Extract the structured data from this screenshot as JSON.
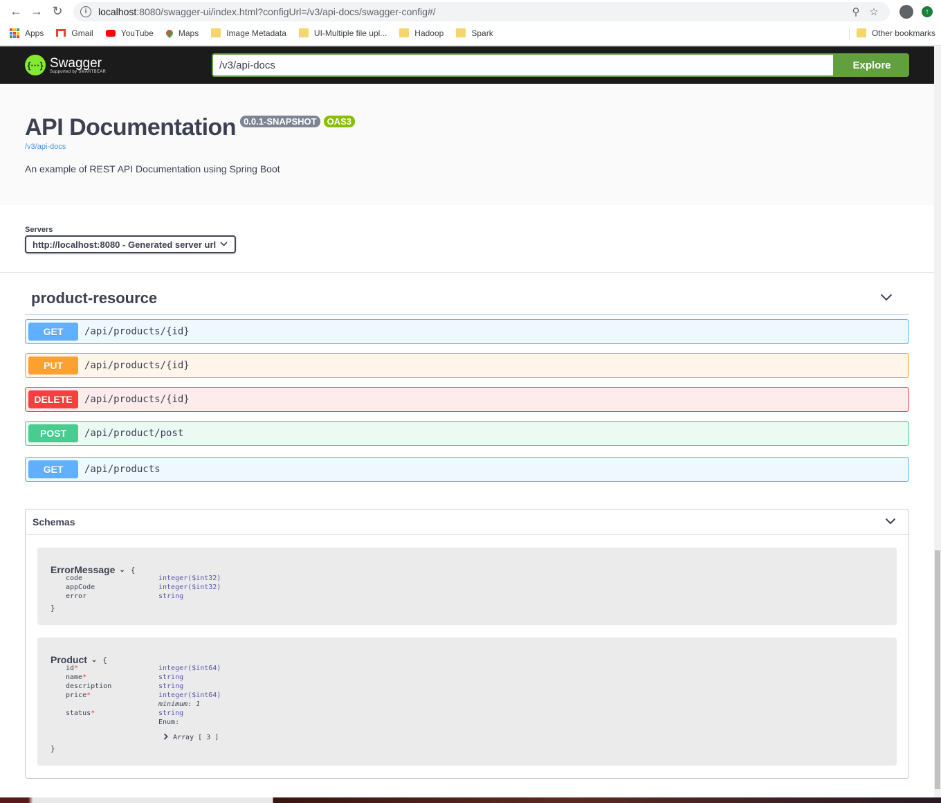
{
  "browser": {
    "url_host": "localhost",
    "url_rest": ":8080/swagger-ui/index.html?configUrl=/v3/api-docs/swagger-config#/",
    "bookmarks": [
      {
        "label": "Apps",
        "kind": "apps"
      },
      {
        "label": "Gmail",
        "kind": "gmail"
      },
      {
        "label": "YouTube",
        "kind": "youtube"
      },
      {
        "label": "Maps",
        "kind": "maps"
      },
      {
        "label": "Image Metadata",
        "kind": "folder"
      },
      {
        "label": "UI-Multiple file upl...",
        "kind": "folder"
      },
      {
        "label": "Hadoop",
        "kind": "folder"
      },
      {
        "label": "Spark",
        "kind": "folder"
      }
    ],
    "other_bookmarks": "Other bookmarks"
  },
  "topbar": {
    "logo_title": "Swagger",
    "logo_sub": "Supported by SMARTBEAR",
    "logo_mark": "{···}",
    "explore_value": "/v3/api-docs",
    "explore_label": "Explore"
  },
  "info": {
    "title": "API Documentation",
    "version": "0.0.1-SNAPSHOT",
    "oas": "OAS3",
    "link": "/v3/api-docs",
    "description": "An example of REST API Documentation using Spring Boot"
  },
  "servers": {
    "label": "Servers",
    "selected": "http://localhost:8080 - Generated server url"
  },
  "tag": {
    "name": "product-resource"
  },
  "operations": [
    {
      "method": "GET",
      "path": "/api/products/{id}"
    },
    {
      "method": "PUT",
      "path": "/api/products/{id}"
    },
    {
      "method": "DELETE",
      "path": "/api/products/{id}"
    },
    {
      "method": "POST",
      "path": "/api/product/post"
    },
    {
      "method": "GET",
      "path": "/api/products"
    }
  ],
  "schemas": {
    "title": "Schemas",
    "models": [
      {
        "name": "ErrorMessage",
        "open_brace": "{",
        "close_brace": "}",
        "properties": [
          {
            "name": "code",
            "required": false,
            "type": "integer($int32)"
          },
          {
            "name": "appCode",
            "required": false,
            "type": "integer($int32)"
          },
          {
            "name": "error",
            "required": false,
            "type": "string"
          }
        ]
      },
      {
        "name": "Product",
        "open_brace": "{",
        "close_brace": "}",
        "properties": [
          {
            "name": "id",
            "required": true,
            "type": "integer($int64)"
          },
          {
            "name": "name",
            "required": true,
            "type": "string"
          },
          {
            "name": "description",
            "required": false,
            "type": "string"
          },
          {
            "name": "price",
            "required": true,
            "type": "integer($int64)",
            "extra": "minimum: 1"
          },
          {
            "name": "status",
            "required": true,
            "type": "string",
            "extra": "Enum:",
            "array": "Array [ 3 ]"
          }
        ]
      }
    ]
  },
  "colors": {
    "get": "#61affe",
    "put": "#fca130",
    "delete": "#f93e3e",
    "post": "#49cc90",
    "accent": "#62a03f",
    "topbar": "#1b1b1b"
  }
}
